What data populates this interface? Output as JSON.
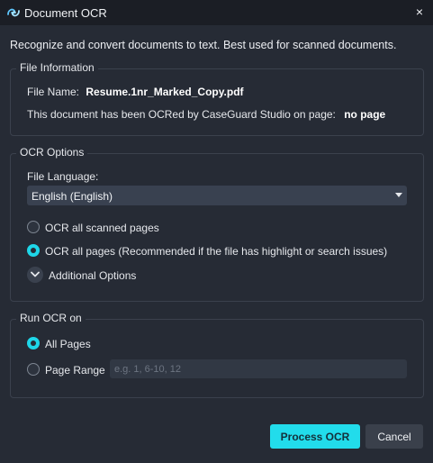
{
  "window": {
    "title": "Document OCR",
    "close_label": "×"
  },
  "intro": "Recognize and convert documents to text. Best used for scanned documents.",
  "file_info": {
    "group_title": "File Information",
    "file_name_label": "File Name:",
    "file_name_value": "Resume.1nr_Marked_Copy.pdf",
    "ocr_status_text": "This document has been OCRed by CaseGuard Studio on page:",
    "ocr_status_value": "no page"
  },
  "ocr_options": {
    "group_title": "OCR Options",
    "language_label": "File Language:",
    "language_selected": "English (English)",
    "radio_scanned": "OCR all scanned pages",
    "radio_all": "OCR all pages (Recommended if the file has highlight or search issues)",
    "selected": "all",
    "additional_options": "Additional Options"
  },
  "run_on": {
    "group_title": "Run OCR on",
    "radio_all_pages": "All Pages",
    "radio_page_range": "Page Range",
    "page_range_placeholder": "e.g. 1, 6-10, 12",
    "selected": "all_pages"
  },
  "buttons": {
    "process": "Process OCR",
    "cancel": "Cancel"
  },
  "colors": {
    "accent": "#22dceb",
    "background": "#262b35",
    "titlebar": "#1b1e25"
  }
}
